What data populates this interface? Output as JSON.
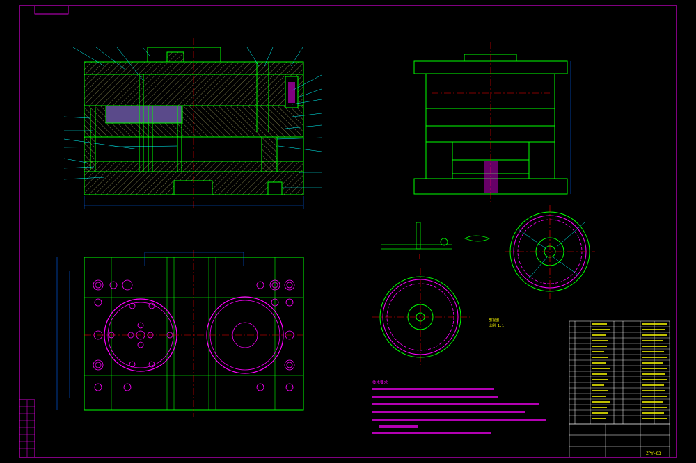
{
  "drawing": {
    "title_label": "ZPY-03",
    "tech_notes_title": "技术要求",
    "tech_notes": [
      "1.",
      "2.",
      "3.",
      "4.",
      "5.",
      "6."
    ],
    "section_label": "剖视图",
    "scale_label": "比例 1:1",
    "colors": {
      "border": "#ff00ff",
      "outline": "#00ff00",
      "hatch": "#aaaa66",
      "centerline": "#ff0000",
      "leader": "#00ffff",
      "dimension": "#0066ff",
      "text": "#ffff00",
      "highlight": "#ff00ff",
      "background": "#000000"
    }
  }
}
